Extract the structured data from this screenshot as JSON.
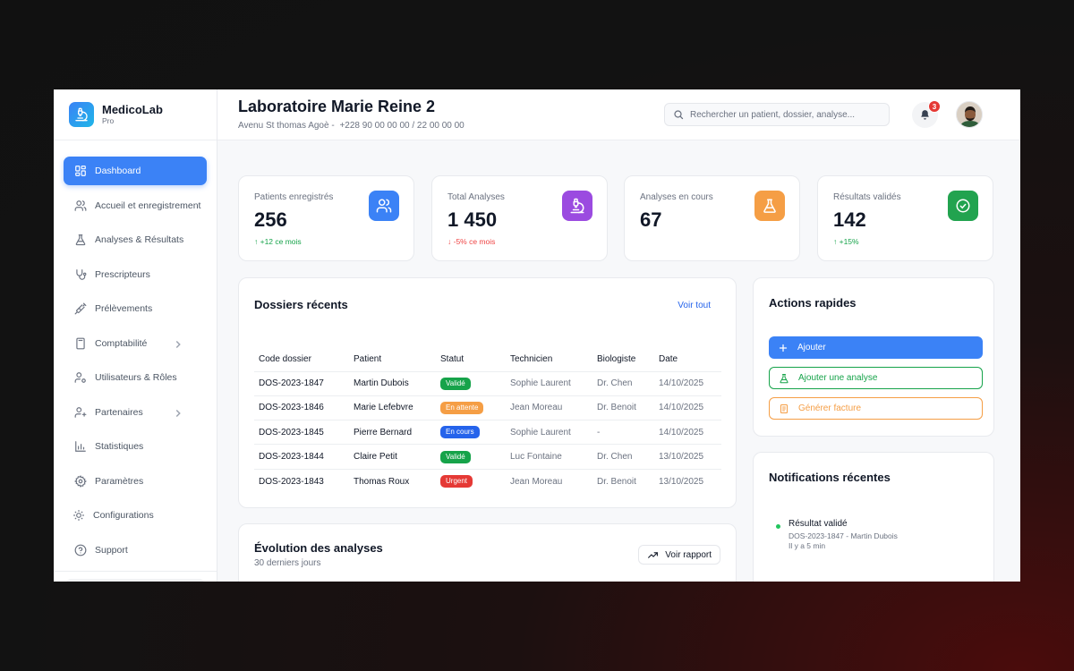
{
  "brand": {
    "name": "MedicoLab",
    "tier": "Pro",
    "logo_icon": "microscope-icon"
  },
  "sidebar": {
    "items": [
      {
        "label": "Dashboard",
        "icon": "grid-icon",
        "active": true
      },
      {
        "label": "Accueil et enregistrement",
        "icon": "users-icon"
      },
      {
        "label": "Analyses & Résultats",
        "icon": "flask-icon"
      },
      {
        "label": "Prescripteurs",
        "icon": "stethoscope-icon"
      },
      {
        "label": "Prélèvements",
        "icon": "syringe-icon"
      },
      {
        "label": "Comptabilité",
        "icon": "calculator-icon",
        "has_submenu": true
      },
      {
        "label": "Utilisateurs & Rôles",
        "icon": "user-cog-icon"
      },
      {
        "label": "Partenaires",
        "icon": "handshake-icon",
        "has_submenu": true
      },
      {
        "label": "Statistiques",
        "icon": "bar-chart-icon"
      },
      {
        "label": "Paramètres",
        "icon": "gear-icon"
      },
      {
        "label": "Configurations",
        "icon": "cog-icon"
      },
      {
        "label": "Support",
        "icon": "help-circle-icon"
      }
    ]
  },
  "header": {
    "title": "Laboratoire Marie Reine 2",
    "address": "Avenu St thomas Agoè -",
    "phone": "+228 90 00 00 00 / 22 00 00 00",
    "search_placeholder": "Rechercher un patient, dossier, analyse...",
    "notification_count": "3"
  },
  "stats": [
    {
      "label": "Patients enregistrés",
      "value": "256",
      "trend": "↑ +12 ce mois",
      "trend_color": "#16a34a",
      "icon": "users-icon",
      "icon_bg": "#3b82f6"
    },
    {
      "label": "Total Analyses",
      "value": "1 450",
      "trend": "↓ -5% ce mois",
      "trend_color": "#ef4444",
      "icon": "microscope-icon",
      "icon_bg": "#9b4be0"
    },
    {
      "label": "Analyses en cours",
      "value": "67",
      "trend": "",
      "icon": "flask-icon",
      "icon_bg": "#f59e45"
    },
    {
      "label": "Résultats validés",
      "value": "142",
      "trend": "↑ +15%",
      "trend_color": "#16a34a",
      "icon": "check-circle-icon",
      "icon_bg": "#22a34f"
    }
  ],
  "dossiers": {
    "title": "Dossiers récents",
    "see_all": "Voir tout",
    "columns": [
      "Code dossier",
      "Patient",
      "Statut",
      "Technicien",
      "Biologiste",
      "Date"
    ],
    "rows": [
      {
        "code": "DOS-2023-1847",
        "patient": "Martin Dubois",
        "status": "Validé",
        "status_color": "#16a34a",
        "technician": "Sophie Laurent",
        "biologist": "Dr. Chen",
        "date": "14/10/2025"
      },
      {
        "code": "DOS-2023-1846",
        "patient": "Marie Lefebvre",
        "status": "En attente",
        "status_color": "#f59e45",
        "technician": "Jean Moreau",
        "biologist": "Dr. Benoit",
        "date": "14/10/2025"
      },
      {
        "code": "DOS-2023-1845",
        "patient": "Pierre Bernard",
        "status": "En cours",
        "status_color": "#2563eb",
        "technician": "Sophie Laurent",
        "biologist": "-",
        "date": "14/10/2025"
      },
      {
        "code": "DOS-2023-1844",
        "patient": "Claire Petit",
        "status": "Validé",
        "status_color": "#16a34a",
        "technician": "Luc Fontaine",
        "biologist": "Dr. Chen",
        "date": "13/10/2025"
      },
      {
        "code": "DOS-2023-1843",
        "patient": "Thomas Roux",
        "status": "Urgent",
        "status_color": "#e53935",
        "technician": "Jean Moreau",
        "biologist": "Dr. Benoit",
        "date": "13/10/2025"
      }
    ]
  },
  "evolution": {
    "title": "Évolution des analyses",
    "subtitle": "30 derniers jours",
    "button": "Voir rapport"
  },
  "quick_actions": {
    "title": "Actions rapides",
    "buttons": [
      {
        "label": "Ajouter",
        "icon": "plus-icon",
        "color": "#3b82f6",
        "style": "filled"
      },
      {
        "label": "Ajouter une analyse",
        "icon": "flask-icon",
        "color": "#16a34a",
        "style": "outline"
      },
      {
        "label": "Générer facture",
        "icon": "invoice-icon",
        "color": "#f59e45",
        "style": "outline"
      }
    ]
  },
  "notifications": {
    "title": "Notifications récentes",
    "items": [
      {
        "title": "Résultat validé",
        "meta": "DOS-2023-1847 - Martin Dubois",
        "time": "Il y a 5 min",
        "dot_color": "#22c55e"
      }
    ]
  }
}
